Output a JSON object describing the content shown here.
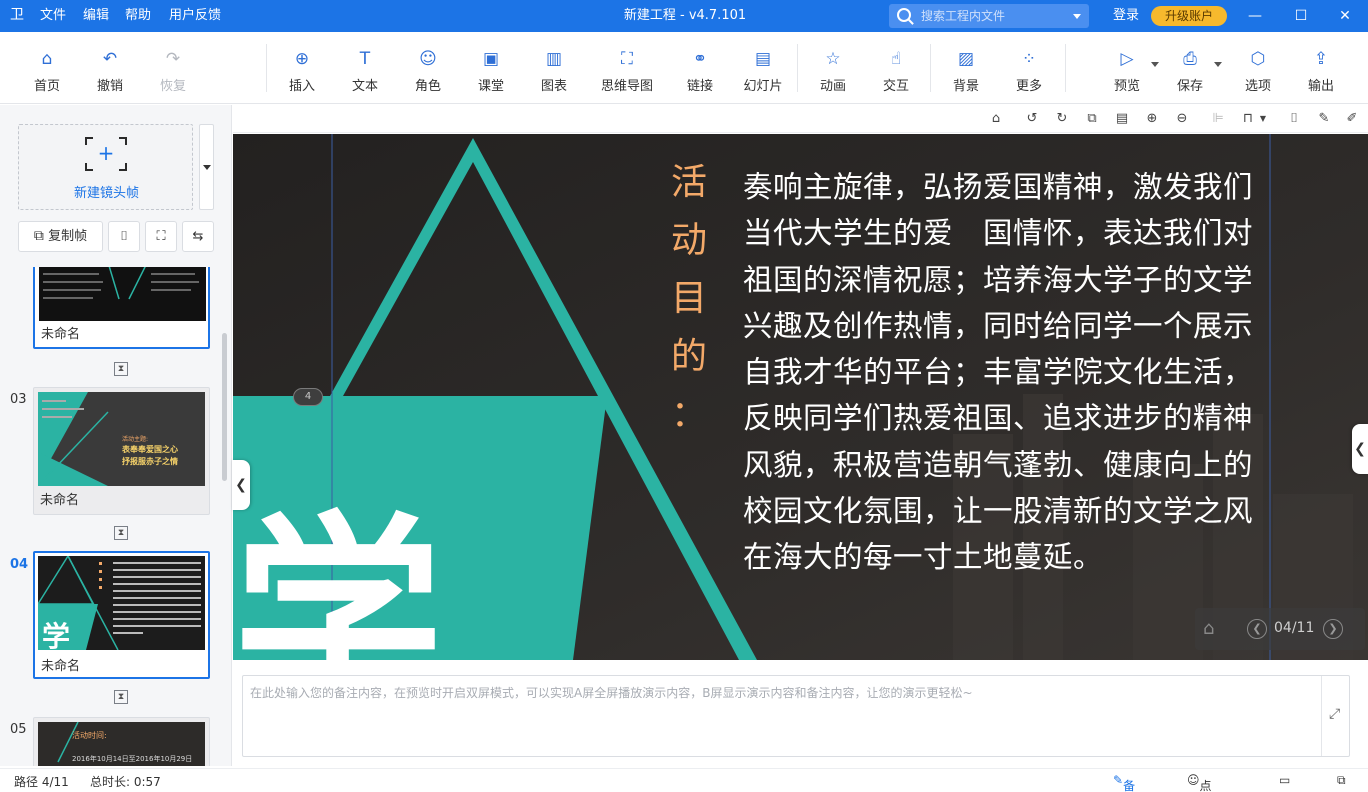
{
  "app": {
    "logo_glyph": "卫",
    "title": "新建工程 - v4.7.101",
    "menus": [
      "文件",
      "编辑",
      "帮助",
      "用户反馈"
    ],
    "search_placeholder": "搜索工程内文件",
    "login": "登录",
    "upgrade": "升级账户",
    "accent_color": "#1c74e6",
    "upgrade_color": "#f7b92d"
  },
  "toolbar": {
    "items": [
      {
        "label": "首页",
        "icon": "home-icon",
        "glyph": "⌂"
      },
      {
        "label": "撤销",
        "icon": "undo-icon",
        "glyph": "↶"
      },
      {
        "label": "恢复",
        "icon": "redo-icon",
        "glyph": "↷",
        "disabled": true
      },
      {
        "label": "插入",
        "icon": "insert-icon",
        "glyph": "⊕"
      },
      {
        "label": "文本",
        "icon": "text-icon",
        "glyph": "T"
      },
      {
        "label": "角色",
        "icon": "character-icon",
        "glyph": "☺"
      },
      {
        "label": "课堂",
        "icon": "classroom-icon",
        "glyph": "▣"
      },
      {
        "label": "图表",
        "icon": "chart-icon",
        "glyph": "▥"
      },
      {
        "label": "思维导图",
        "icon": "mindmap-icon",
        "glyph": "⛶"
      },
      {
        "label": "链接",
        "icon": "link-icon",
        "glyph": "⚭"
      },
      {
        "label": "幻灯片",
        "icon": "slides-icon",
        "glyph": "▤"
      },
      {
        "label": "动画",
        "icon": "animation-icon",
        "glyph": "☆"
      },
      {
        "label": "交互",
        "icon": "interaction-icon",
        "glyph": "☝"
      },
      {
        "label": "背景",
        "icon": "background-icon",
        "glyph": "▨"
      },
      {
        "label": "更多",
        "icon": "more-icon",
        "glyph": "⁘"
      },
      {
        "label": "预览",
        "icon": "preview-icon",
        "glyph": "▷"
      },
      {
        "label": "保存",
        "icon": "save-icon",
        "glyph": "⎙"
      },
      {
        "label": "选项",
        "icon": "options-icon",
        "glyph": "⬡"
      },
      {
        "label": "输出",
        "icon": "export-icon",
        "glyph": "⇪"
      }
    ]
  },
  "leftpanel": {
    "new_frame": "新建镜头帧",
    "copy_frame": "复制帧",
    "frames": [
      {
        "number": "",
        "name": "未命名"
      },
      {
        "number": "03",
        "name": "未命名",
        "thumb_title": "表奉奉爱国之心\n抒报服赤子之情",
        "thumb_sub": "活动主题:"
      },
      {
        "number": "04",
        "name": "未命名",
        "selected": true
      },
      {
        "number": "05",
        "name": "",
        "thumb_title": "活动时间:",
        "thumb_sub": "2016年10月14日至2016年10月29日"
      }
    ]
  },
  "slide": {
    "title_chars": [
      "活",
      "动",
      "目",
      "的",
      "："
    ],
    "body": "奏响主旋律，弘扬爱国精神，激发我们当代大学生的爱　国情怀，表达我们对祖国的深情祝愿；培养海大学子的文学兴趣及创作热情，同时给同学一个展示自我才华的平台；丰富学院文化生活，反映同学们热爱祖国、追求进步的精神风貌，积极营造朝气蓬勃、健康向上的校园文化氛围，让一股清新的文学之风在海大的每一寸土地蔓延。",
    "big_char": "学",
    "frame_badge": "4",
    "counter": "04/11",
    "teal_color": "#2bb3a3",
    "title_color": "#f3a969"
  },
  "notes": {
    "placeholder": "在此处输入您的备注内容，在预览时开启双屏模式，可以实现A屏全屏播放演示内容，B屏显示演示内容和备注内容，让您的演示更轻松~"
  },
  "status": {
    "path": "路径 4/11",
    "duration": "总时长: 0:57",
    "notes_btn": "备注",
    "rollcall_btn": "点名"
  }
}
